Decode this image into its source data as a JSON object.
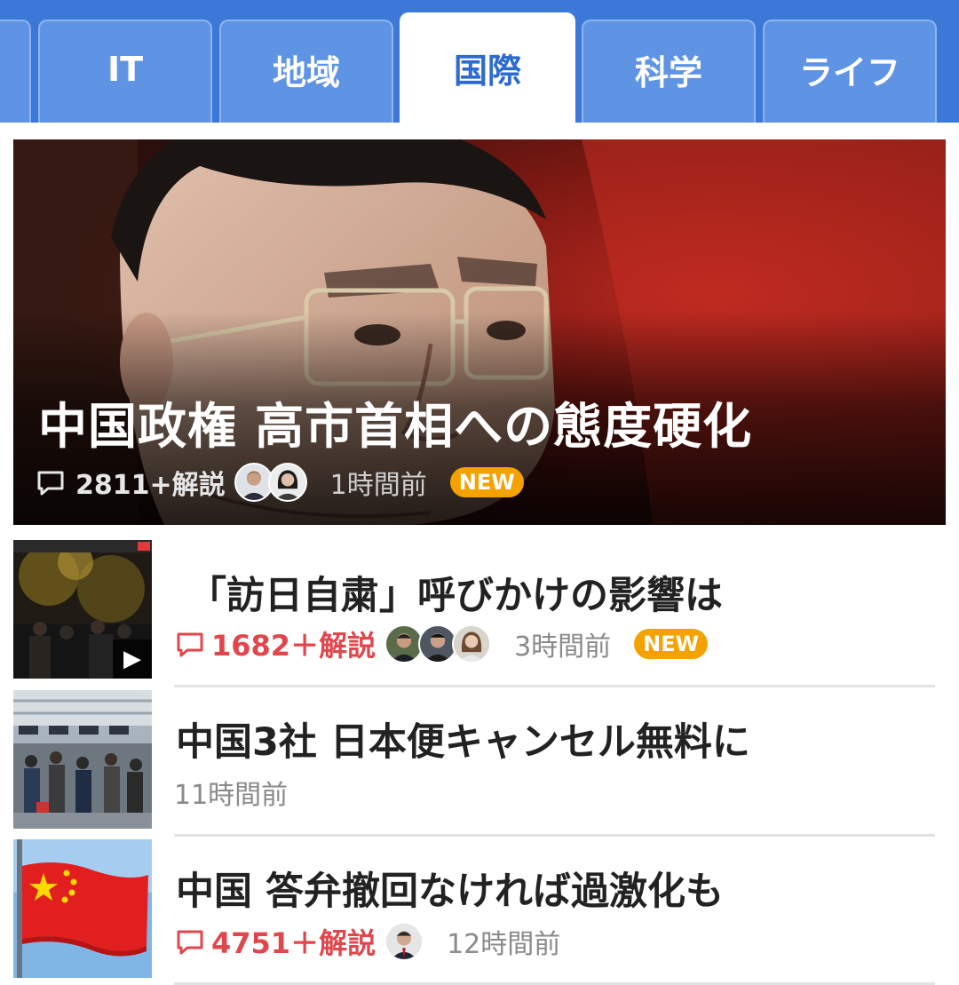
{
  "tabs": [
    {
      "label": "",
      "active": false
    },
    {
      "label": "IT",
      "active": false
    },
    {
      "label": "地域",
      "active": false
    },
    {
      "label": "国際",
      "active": true
    },
    {
      "label": "科学",
      "active": false
    },
    {
      "label": "ライフ",
      "active": false
    }
  ],
  "hero": {
    "title": "中国政権 高市首相への態度硬化",
    "comments": "2811+解説",
    "commentator_count": 2,
    "time": "1時間前",
    "badge": "NEW"
  },
  "articles": [
    {
      "title": "「訪日自粛」呼びかけの影響は",
      "comments": "1682＋解説",
      "commentator_count": 3,
      "time": "3時間前",
      "badge": "NEW",
      "video": true,
      "thumb_icon": "night-crowd-photo"
    },
    {
      "title": "中国3社 日本便キャンセル無料に",
      "comments": "",
      "commentator_count": 0,
      "time": "11時間前",
      "badge": "",
      "video": false,
      "thumb_icon": "airport-crowd-photo"
    },
    {
      "title": "中国 答弁撤回なければ過激化も",
      "comments": "4751＋解説",
      "commentator_count": 1,
      "time": "12時間前",
      "badge": "",
      "video": false,
      "thumb_icon": "china-flag-photo"
    }
  ],
  "icons": {
    "comment": "speech-bubble-icon",
    "video": "play-icon"
  },
  "colors": {
    "tab_bg": "#3b78d8",
    "tab_active_text": "#2e6bd0",
    "comment_red": "#e0474c",
    "new_badge": "#f5a200"
  }
}
